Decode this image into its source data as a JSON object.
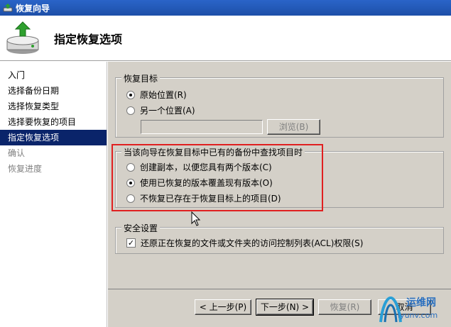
{
  "window": {
    "title": "恢复向导"
  },
  "header": {
    "page_title": "指定恢复选项"
  },
  "sidebar": {
    "items": [
      {
        "label": "入门",
        "state": "normal"
      },
      {
        "label": "选择备份日期",
        "state": "normal"
      },
      {
        "label": "选择恢复类型",
        "state": "normal"
      },
      {
        "label": "选择要恢复的项目",
        "state": "normal"
      },
      {
        "label": "指定恢复选项",
        "state": "selected"
      },
      {
        "label": "确认",
        "state": "disabled"
      },
      {
        "label": "恢复进度",
        "state": "disabled"
      }
    ]
  },
  "recovery_target": {
    "group_label": "恢复目标",
    "original_location": "原始位置(R)",
    "another_location": "另一个位置(A)",
    "path_value": "",
    "browse_label": "浏览(B)"
  },
  "existing_items": {
    "group_label": "当该向导在恢复目标中已有的备份中查找项目时",
    "create_copy": "创建副本，以便您具有两个版本(C)",
    "overwrite": "使用已恢复的版本覆盖现有版本(O)",
    "skip": "不恢复已存在于恢复目标上的项目(D)"
  },
  "security": {
    "group_label": "安全设置",
    "restore_acl": "还原正在恢复的文件或文件夹的访问控制列表(ACL)权限(S)",
    "restore_acl_checked": true
  },
  "buttons": {
    "back": "< 上一步(P)",
    "next": "下一步(N) >",
    "recover": "恢复(R)",
    "cancel": "取消"
  },
  "watermark": {
    "top": "运维网",
    "bottom": "iyunv.com"
  },
  "colors": {
    "selection": "#0a246a",
    "dialog_bg": "#d4d0c8",
    "highlight_box": "#e02020",
    "titlebar": "#2a64c8"
  }
}
